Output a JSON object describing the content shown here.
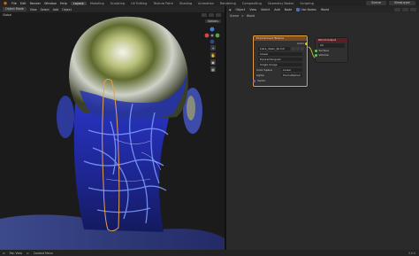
{
  "topbar": {
    "menus": [
      "File",
      "Edit",
      "Render",
      "Window",
      "Help"
    ],
    "workspaces": [
      "Layout",
      "Modeling",
      "Sculpting",
      "UV Editing",
      "Texture Paint",
      "Shading",
      "Animation",
      "Rendering",
      "Compositing",
      "Geometry Nodes",
      "Scripting"
    ],
    "active_workspace": "Layout",
    "scene_field": "Scene",
    "view_layer_field": "ViewLayer"
  },
  "viewport": {
    "header_items": [
      "Object Mode",
      "View",
      "Select",
      "Add",
      "Object"
    ],
    "header2_items": [
      "Global",
      "Options"
    ],
    "options_label": "Options"
  },
  "node_editor": {
    "header_items": [
      "Object",
      "View",
      "Select",
      "Add",
      "Node"
    ],
    "use_nodes_label": "Use Nodes",
    "world_label": "World",
    "breadcrumb": [
      "Scene",
      ">",
      "World"
    ],
    "env_node": {
      "title": "Environment Texture",
      "color_out": "Color",
      "image_name": "kiara_dawn_4k.hdr",
      "rows": [
        "Linear",
        "Equirectangular",
        "Single Image",
        "Color Space",
        "Alpha",
        "Vector"
      ],
      "color_space_value": "Linear",
      "alpha_value": "Premultiplied"
    },
    "world_output": {
      "title": "World Output",
      "target": "All",
      "inputs": [
        "Surface",
        "Volume"
      ]
    }
  },
  "statusbar": {
    "items": [
      "Pan View",
      "Context Menu"
    ],
    "version": "3.0.0"
  },
  "colors": {
    "accent": "#e87d0d",
    "selection": "#e8a046",
    "node_link": "#c7c729"
  }
}
